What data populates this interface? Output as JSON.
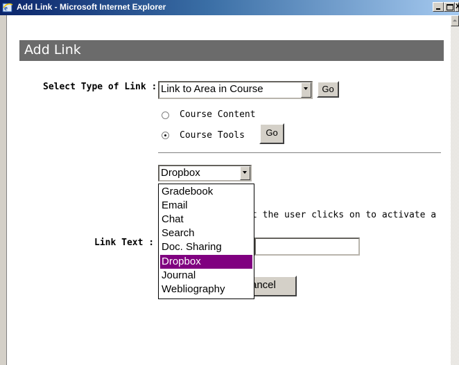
{
  "window": {
    "title": "Add Link - Microsoft Internet Explorer",
    "close_glyph": "x"
  },
  "page": {
    "heading": "Add Link"
  },
  "form": {
    "select_type_label": "Select Type of Link :",
    "link_type_value": "Link to Area in Course",
    "go_label": "Go",
    "radio_course_content": "Course Content",
    "radio_course_tools": "Course Tools",
    "radio_selected": "Course Tools",
    "tool_select_value": "Dropbox",
    "link_text_label": "Link Text :",
    "link_text_value": "",
    "info_text_partial": "t the user clicks on to activate a",
    "cancel_partial": "ancel"
  },
  "dropdown": {
    "options": [
      "Gradebook",
      "Email",
      "Chat",
      "Search",
      "Doc. Sharing",
      "Dropbox",
      "Journal",
      "Webliography"
    ],
    "highlighted": "Dropbox"
  },
  "colors": {
    "title_bar": "#0a246a",
    "header_band": "#6b6b6b",
    "highlight": "#800080"
  }
}
